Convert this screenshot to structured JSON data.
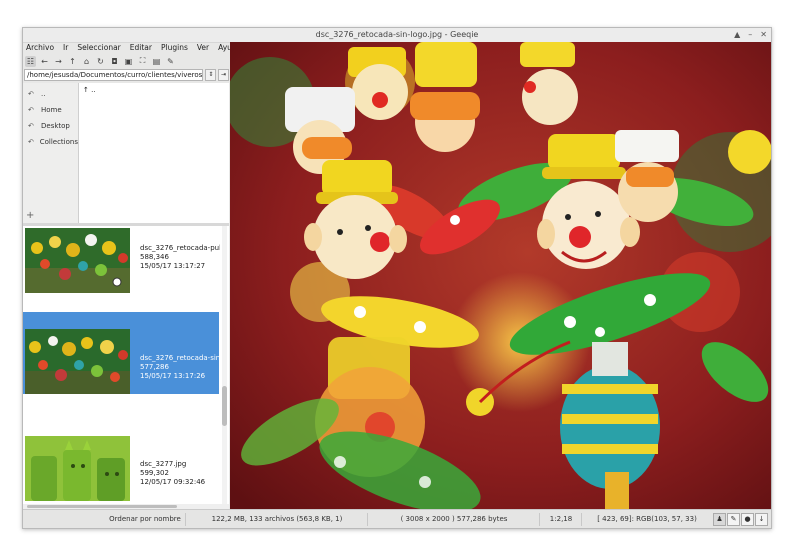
{
  "window": {
    "title": "dsc_3276_retocada-sin-logo.jpg - Geeqie",
    "controls": [
      "▲",
      "–",
      "✕"
    ]
  },
  "menu": [
    "Archivo",
    "Ir",
    "Seleccionar",
    "Editar",
    "Plugins",
    "Ver",
    "Ayuda"
  ],
  "toolbar": {
    "icons": [
      "thumbnails-toggle-icon",
      "back-icon",
      "forward-icon",
      "up-icon",
      "home-icon",
      "refresh-icon",
      "zoom-in-icon",
      "zoom-out-icon",
      "zoom-fit-icon",
      "zoom-100-icon",
      "settings-icon"
    ]
  },
  "path": {
    "value": "/home/jesusda/Documentos/curro/clientes/viverosmurc"
  },
  "bookmarks": [
    {
      "label": ".."
    },
    {
      "label": "Home"
    },
    {
      "label": "Desktop"
    },
    {
      "label": "Collections"
    }
  ],
  "folders": [
    {
      "label": ".."
    }
  ],
  "files": [
    {
      "name": "dsc_3276_retocada-publi",
      "size": "588,346",
      "date": "15/05/17 13:17:27",
      "selected": false
    },
    {
      "name": "dsc_3276_retocada-sin-lo",
      "size": "577,286",
      "date": "15/05/17 13:17:26",
      "selected": true
    },
    {
      "name": "dsc_3277.jpg",
      "size": "599,302",
      "date": "12/05/17 09:32:46",
      "selected": false
    }
  ],
  "status": {
    "sort": "Ordenar por nombre",
    "summary": "122,2 MB, 133 archivos (563,8 KB, 1)",
    "image_info": "( 3008 x 2000 ) 577,286 bytes",
    "zoom": "1:2,18",
    "pixel": "[ 423, 69]: RGB(103, 57, 33)"
  },
  "colors": {
    "selection": "#4a90d9",
    "image_bg": "#7a1416"
  }
}
